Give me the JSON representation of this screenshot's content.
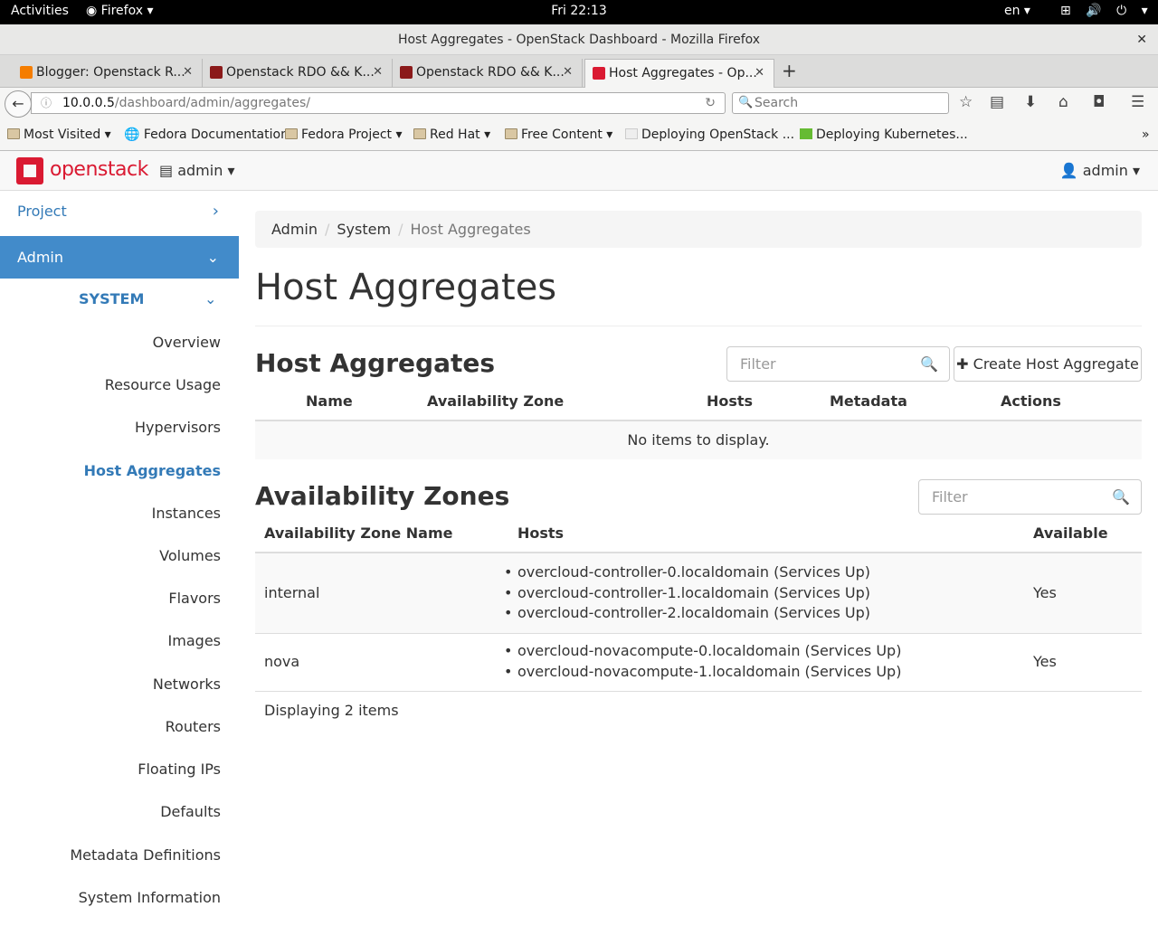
{
  "os_bar": {
    "activities": "Activities",
    "app": "Firefox ▾",
    "clock": "Fri 22:13",
    "lang": "en ▾",
    "system_icons": "⊞ 🔊 ⏻ ▾"
  },
  "window": {
    "title": "Host Aggregates - OpenStack Dashboard - Mozilla Firefox",
    "close": "✕"
  },
  "tabs": [
    {
      "label": "Blogger: Openstack R...",
      "close": "✕",
      "color": "#f57d00"
    },
    {
      "label": "Openstack RDO && K...",
      "close": "✕",
      "color": "#8b1a1a"
    },
    {
      "label": "Openstack RDO && K...",
      "close": "✕",
      "color": "#8b1a1a"
    },
    {
      "label": "Host Aggregates - Op...",
      "close": "✕",
      "color": "#da1a32"
    }
  ],
  "new_tab": "+",
  "url": {
    "host": "10.0.0.5",
    "path": "/dashboard/admin/aggregates/"
  },
  "search_placeholder": "Search",
  "bookmarks": [
    {
      "label": "Most Visited ▾"
    },
    {
      "label": "Fedora Documentation"
    },
    {
      "label": "Fedora Project ▾"
    },
    {
      "label": "Red Hat ▾"
    },
    {
      "label": "Free Content ▾"
    },
    {
      "label": "Deploying OpenStack ..."
    },
    {
      "label": "Deploying Kubernetes..."
    }
  ],
  "bookmarks_more": "»",
  "header": {
    "logo_text": "openstack",
    "project": "admin ▾",
    "user": "admin ▾"
  },
  "sidebar": {
    "project": "Project",
    "admin": "Admin",
    "system": "SYSTEM",
    "items": [
      "Overview",
      "Resource Usage",
      "Hypervisors",
      "Host Aggregates",
      "Instances",
      "Volumes",
      "Flavors",
      "Images",
      "Networks",
      "Routers",
      "Floating IPs",
      "Defaults",
      "Metadata Definitions",
      "System Information"
    ],
    "active_index": 3
  },
  "breadcrumb": {
    "admin": "Admin",
    "system": "System",
    "current": "Host Aggregates"
  },
  "page_title": "Host Aggregates",
  "aggregates": {
    "title": "Host Aggregates",
    "filter_placeholder": "Filter",
    "create_button": "Create Host Aggregate",
    "columns": [
      "Name",
      "Availability Zone",
      "Hosts",
      "Metadata",
      "Actions"
    ],
    "empty": "No items to display."
  },
  "zones": {
    "title": "Availability Zones",
    "filter_placeholder": "Filter",
    "columns": [
      "Availability Zone Name",
      "Hosts",
      "Available"
    ],
    "rows": [
      {
        "name": "internal",
        "hosts": [
          "overcloud-controller-0.localdomain (Services Up)",
          "overcloud-controller-1.localdomain (Services Up)",
          "overcloud-controller-2.localdomain (Services Up)"
        ],
        "available": "Yes"
      },
      {
        "name": "nova",
        "hosts": [
          "overcloud-novacompute-0.localdomain (Services Up)",
          "overcloud-novacompute-1.localdomain (Services Up)"
        ],
        "available": "Yes"
      }
    ],
    "footer": "Displaying 2 items"
  }
}
